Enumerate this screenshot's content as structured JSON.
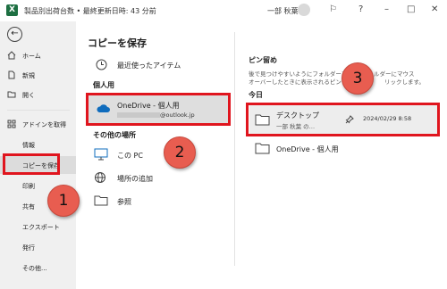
{
  "titlebar": {
    "app_title": "製品別出荷台数 • 最終更新日時: 43 分前",
    "user": "一部 秋葉",
    "help": "?"
  },
  "sidebar": {
    "back": "←",
    "items": [
      {
        "label": "ホーム",
        "icon": "home-icon"
      },
      {
        "label": "新規",
        "icon": "new-file-icon"
      },
      {
        "label": "開く",
        "icon": "open-folder-icon"
      },
      {
        "label": "アドインを取得",
        "icon": "addin-grid-icon"
      },
      {
        "label": "情報"
      },
      {
        "label": "コピーを保存"
      },
      {
        "label": "印刷"
      },
      {
        "label": "共有"
      },
      {
        "label": "エクスポート"
      },
      {
        "label": "発行"
      },
      {
        "label": "その他..."
      }
    ]
  },
  "main": {
    "title": "コピーを保存",
    "recent": "最近使ったアイテム",
    "personal_group": "個人用",
    "onedrive_label": "OneDrive - 個人用",
    "onedrive_email": "@outlook.jp",
    "other_group": "その他の場所",
    "this_pc": "この PC",
    "add_place": "場所の追加",
    "browse": "参照"
  },
  "right": {
    "pinned_title": "ピン留め",
    "pinned_desc_1": "後で見つけやすいようにフォルダーをピン",
    "pinned_desc_2": "フォルダーにマウス",
    "pinned_desc_3": "オーバーしたときに表示されるピン",
    "pinned_desc_4": "リックします。",
    "today": "今日",
    "folders": [
      {
        "name": "デスクトップ",
        "sub": "一部 秋葉 の…",
        "date": "2024/02/29 8:58"
      },
      {
        "name": "OneDrive - 個人用"
      }
    ]
  },
  "callouts": [
    "1",
    "2",
    "3"
  ],
  "colors": {
    "highlight": "#e0151e",
    "bubble": "#e85d50",
    "excel_green": "#1d6f42",
    "onedrive_blue": "#0f6cbd"
  }
}
